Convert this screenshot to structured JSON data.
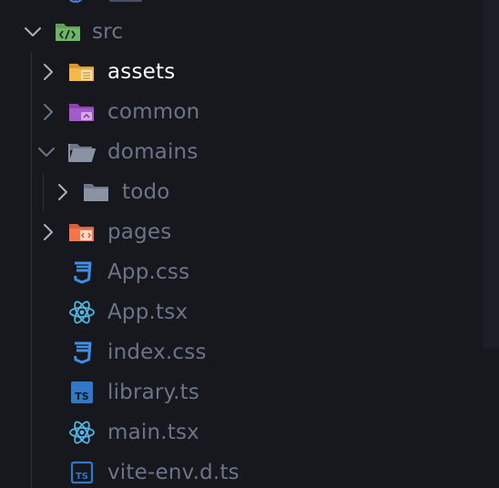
{
  "explorer": {
    "src_folder": {
      "label": "src",
      "icon": "src-folder-icon",
      "expanded": true
    },
    "items": {
      "assets": {
        "label": "assets",
        "icon": "assets-folder-icon",
        "expanded": false
      },
      "common": {
        "label": "common",
        "icon": "common-folder-icon",
        "expanded": false
      },
      "domains": {
        "label": "domains",
        "icon": "folder-open-icon",
        "expanded": true
      },
      "todo": {
        "label": "todo",
        "icon": "folder-icon",
        "expanded": false
      },
      "pages": {
        "label": "pages",
        "icon": "pages-folder-icon",
        "expanded": false
      },
      "app_css": {
        "label": "App.css",
        "icon": "css-icon"
      },
      "app_tsx": {
        "label": "App.tsx",
        "icon": "react-icon"
      },
      "index_css": {
        "label": "index.css",
        "icon": "css-icon"
      },
      "library_ts": {
        "label": "library.ts",
        "icon": "typescript-icon"
      },
      "main_tsx": {
        "label": "main.tsx",
        "icon": "react-icon"
      },
      "vite_env": {
        "label": "vite-env.d.ts",
        "icon": "typescript-icon"
      }
    },
    "colors": {
      "background": "#16181d",
      "text_muted": "#6c7488",
      "text_active": "#ffffff",
      "folder_yellow": "#f2b84b",
      "folder_purple": "#a35bc9",
      "folder_orange": "#f2764b",
      "folder_gray": "#8b93a3",
      "src_green": "#5f9f58",
      "css_blue": "#3f8fe6",
      "react_blue": "#4fb8e6",
      "ts_blue": "#3178c6"
    }
  }
}
